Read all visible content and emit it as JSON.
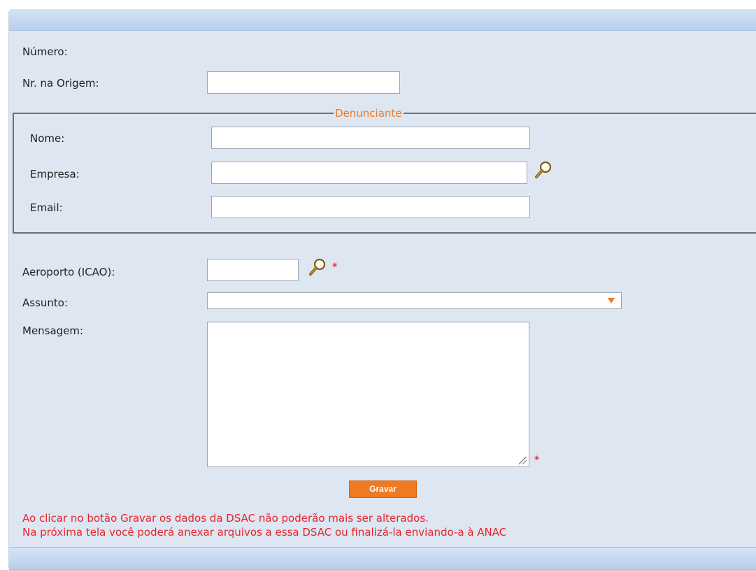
{
  "form": {
    "numero_label": "Número:",
    "origem_label": "Nr. na Origem:",
    "origem_value": "",
    "denunciante": {
      "legend": "Denunciante",
      "nome_label": "Nome:",
      "nome_value": "",
      "empresa_label": "Empresa:",
      "empresa_value": "",
      "email_label": "Email:",
      "email_value": ""
    },
    "aeroporto_label": "Aeroporto (ICAO):",
    "aeroporto_value": "",
    "assunto_label": "Assunto:",
    "assunto_selected": "",
    "mensagem_label": "Mensagem:",
    "mensagem_value": "",
    "required_mark": "*",
    "gravar_label": "Gravar",
    "warning_line1": "Ao clicar no botão Gravar os dados da DSAC não poderão mais ser alterados.",
    "warning_line2": "Na próxima tela você poderá anexar arquivos a essa DSAC ou finalizá-la enviando-a à ANAC"
  },
  "icons": {
    "search": "magnifier-icon",
    "dropdown": "triangle-down-icon"
  },
  "colors": {
    "accent_orange": "#f07a23",
    "warning_red": "#e8232b",
    "panel_bg": "#dde6f1",
    "header_band": "#b7ceec"
  }
}
